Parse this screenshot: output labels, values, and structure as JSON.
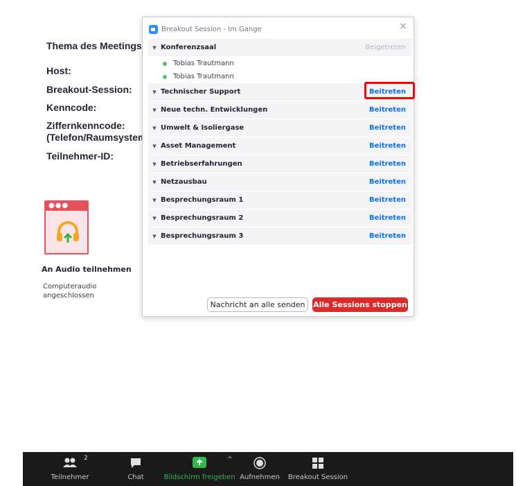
{
  "meeting_info": {
    "topic_label": "Thema des Meetings:",
    "host_label": "Host:",
    "breakout_label": "Breakout-Session:",
    "passcode_label": "Kenncode:",
    "numeric_passcode_label_1": "Ziffernkenncode:",
    "numeric_passcode_label_2": "(Telefon/Raumsystem",
    "participant_id_label": "Teilnehmer-ID:"
  },
  "audio": {
    "title": "An Audio teilnehmen",
    "status_1": "Computeraudio",
    "status_2": "angeschlossen",
    "icon": "headphones-upload-icon"
  },
  "dialog": {
    "title": "Breakout Session - Im Gange",
    "close": "×",
    "rooms": [
      {
        "name": "Konferenzsaal",
        "action": "Beigetreten",
        "joined": true,
        "participants": [
          "Tobias Trautmann",
          "Tobias Trautmann"
        ]
      },
      {
        "name": "Technischer Support",
        "action": "Beitreten"
      },
      {
        "name": "Neue techn. Entwicklungen",
        "action": "Beitreten"
      },
      {
        "name": "Umwelt & Isoliergase",
        "action": "Beitreten"
      },
      {
        "name": "Asset Management",
        "action": "Beitreten"
      },
      {
        "name": "Betriebserfahrungen",
        "action": "Beitreten"
      },
      {
        "name": "Netzausbau",
        "action": "Beitreten"
      },
      {
        "name": "Besprechungsraum 1",
        "action": "Beitreten"
      },
      {
        "name": "Besprechungsraum 2",
        "action": "Beitreten"
      },
      {
        "name": "Besprechungsraum 3",
        "action": "Beitreten"
      }
    ],
    "broadcast_button": "Nachricht an alle senden",
    "stop_button": "Alle Sessions stoppen",
    "stop_button_color": "#e02828",
    "join_color": "#0e71eb"
  },
  "toolbar": {
    "participants_label": "Teilnehmer",
    "participants_count": "2",
    "chat_label": "Chat",
    "share_label": "Bildschirm freigeben",
    "share_caret": "^",
    "record_label": "Aufnehmen",
    "breakout_label": "Breakout Session",
    "share_color": "#33b84e"
  }
}
